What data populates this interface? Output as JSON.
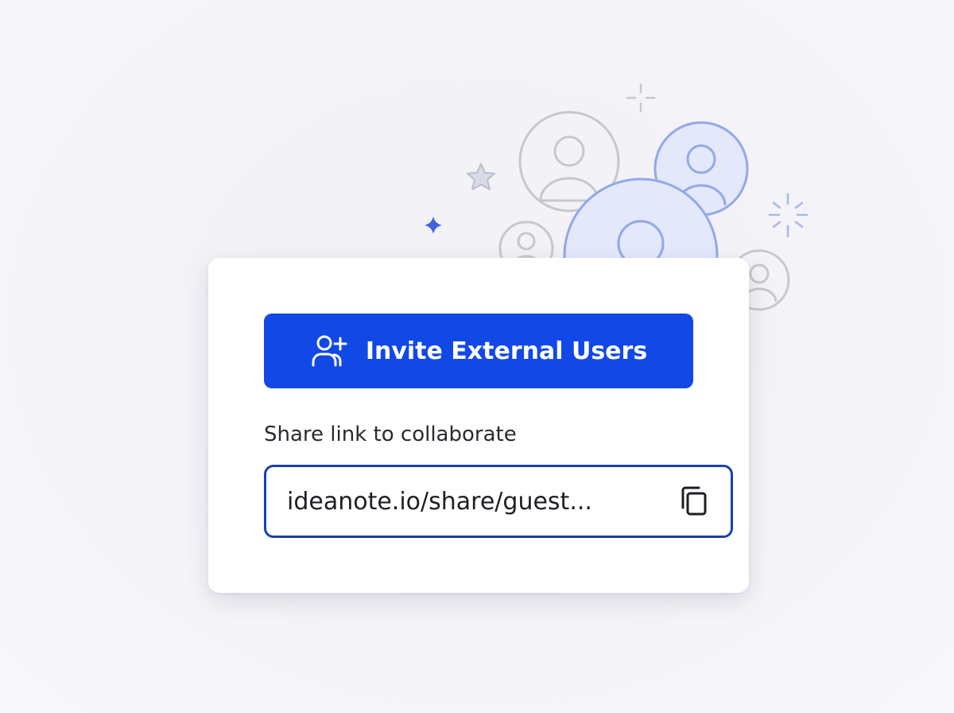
{
  "invite": {
    "label": "Invite External Users",
    "icon": "user-plus-icon"
  },
  "share": {
    "label": "Share link to collaborate",
    "link": "ideanote.io/share/guest...",
    "copy_icon": "copy-icon"
  },
  "colors": {
    "primary": "#1148e6",
    "field_border": "#1b3fae",
    "avatar_fill": "#e3e8fb",
    "avatar_stroke": "#93a8e6",
    "avatar_gray": "#c8c8cc",
    "sparkle_blue": "#3f63d8"
  }
}
